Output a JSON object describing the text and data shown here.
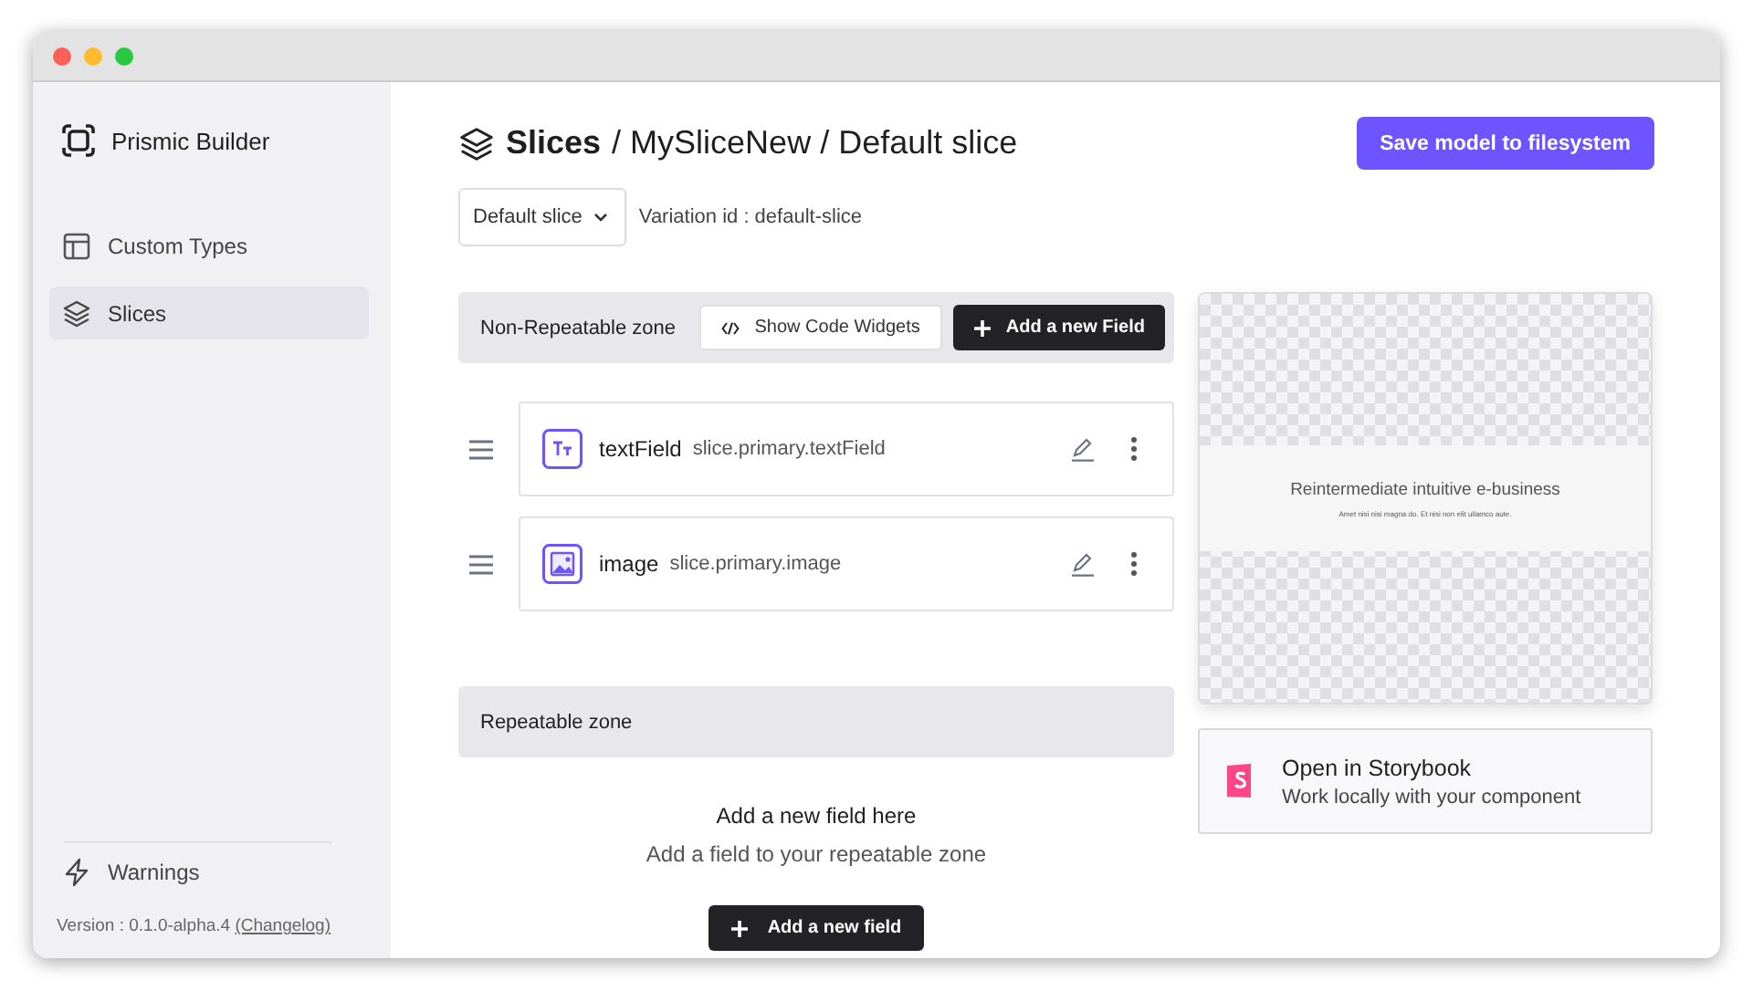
{
  "sidebar": {
    "brand": "Prismic Builder",
    "items": [
      {
        "kind": "layout",
        "label": "Custom Types",
        "selected": false
      },
      {
        "kind": "layers",
        "label": "Slices",
        "selected": true
      }
    ],
    "warnings": "Warnings",
    "version": "Version : 0.1.0-alpha.4",
    "changelog": "(Changelog)"
  },
  "header": {
    "title": "Slices",
    "path": "/ MySliceNew / Default slice",
    "save_button": "Save model to filesystem"
  },
  "variation": {
    "dropdown": "Default slice",
    "id_label": "Variation id : default-slice"
  },
  "non_repeatable_zone": {
    "title": "Non-Repeatable zone",
    "code_button": "Show Code Widgets",
    "add_button": "Add a new Field",
    "fields": [
      {
        "kind": "text",
        "name": "textField",
        "path": "slice.primary.textField"
      },
      {
        "kind": "image",
        "name": "image",
        "path": "slice.primary.image"
      }
    ]
  },
  "repeatable_zone": {
    "title": "Repeatable zone",
    "empty_title": "Add a new field here",
    "empty_text": "Add a field to your repeatable zone",
    "add_button": "Add a new field"
  },
  "preview": {
    "heading": "Reintermediate intuitive e-business",
    "subtext": "Amet nisi nisi magna do. Et nisi non elit ullamco aute."
  },
  "storybook": {
    "title": "Open in Storybook",
    "subtitle": "Work locally with your component"
  }
}
